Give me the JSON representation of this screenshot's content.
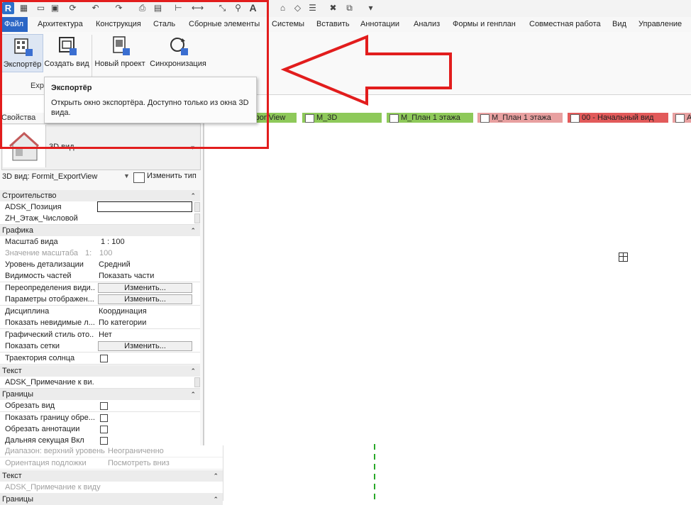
{
  "app": {
    "logo_letter": "R"
  },
  "quick_access": {
    "icons": [
      "open-icon",
      "save-icon",
      "sync-icon",
      "undo-icon",
      "redo-icon",
      "print-icon",
      "measure-icon",
      "dimension-icon",
      "tag-icon",
      "text-icon",
      "3d-view-icon",
      "section-icon",
      "thin-lines-icon",
      "close-views-icon",
      "switch-windows-icon"
    ]
  },
  "ribbon_tabs": [
    {
      "label": "Файл",
      "active": true
    },
    {
      "label": "Архитектура"
    },
    {
      "label": "Конструкция"
    },
    {
      "label": "Сталь"
    },
    {
      "label": "Сборные элементы"
    },
    {
      "label": "Системы"
    },
    {
      "label": "Вставить"
    },
    {
      "label": "Аннотации"
    },
    {
      "label": "Анализ"
    },
    {
      "label": "Формы и генплан"
    },
    {
      "label": "Совместная работа"
    },
    {
      "label": "Вид"
    },
    {
      "label": "Управление"
    }
  ],
  "ribbon": {
    "buttons": [
      {
        "label": "Экспортёр",
        "icon": "building-export-icon"
      },
      {
        "label": "Создать вид",
        "icon": "create-view-icon"
      },
      {
        "label": "Новый проект",
        "icon": "new-project-icon"
      },
      {
        "label": "Синхронизация",
        "icon": "sync-icon"
      }
    ],
    "panel_label": "Expo"
  },
  "tooltip": {
    "title": "Экспортёр",
    "body": "Открыть окно экспортёра. Доступно только из окна 3D вида."
  },
  "view_tabs": [
    {
      "label": "rportView",
      "color": "#8ec95a"
    },
    {
      "label": "M_3D",
      "color": "#8ec95a"
    },
    {
      "label": "M_План 1 этажа",
      "color": "#8ec95a"
    },
    {
      "label": "M_План 1 этажа",
      "color": "#e8a0a0"
    },
    {
      "label": "00 - Начальный вид",
      "color": "#e25a5a"
    },
    {
      "label": "A_",
      "color": "#e8a0a0"
    }
  ],
  "properties": {
    "title": "Свойства",
    "type_name": "3D вид",
    "instance_label": "3D вид: Formit_ExportView",
    "edit_type": "Изменить тип",
    "groups": [
      {
        "name": "Строительство"
      },
      {
        "name": "Графика"
      },
      {
        "name": "Текст"
      },
      {
        "name": "Границы"
      }
    ],
    "rows": {
      "adsk_pos": {
        "k": "ADSK_Позиция"
      },
      "zh_floor": {
        "k": "ZH_Этаж_Числовой"
      },
      "scale": {
        "k": "Масштаб вида",
        "v": "1 : 100"
      },
      "scale_val": {
        "k": "Значение масштаба",
        "k2": "1:",
        "v": "100"
      },
      "detail": {
        "k": "Уровень детализации",
        "v": "Средний"
      },
      "parts": {
        "k": "Видимость частей",
        "v": "Показать части"
      },
      "overrides": {
        "k": "Переопределения види...",
        "v": "Изменить..."
      },
      "display": {
        "k": "Параметры отображен...",
        "v": "Изменить..."
      },
      "discipline": {
        "k": "Дисциплина",
        "v": "Координация"
      },
      "hidden": {
        "k": "Показать невидимые л...",
        "v": "По категории"
      },
      "graphic": {
        "k": "Графический стиль ото...",
        "v": "Нет"
      },
      "grids": {
        "k": "Показать сетки",
        "v": "Изменить..."
      },
      "sun": {
        "k": "Траектория солнца"
      },
      "note": {
        "k": "ADSK_Примечание к ви..."
      },
      "crop": {
        "k": "Обрезать вид"
      },
      "crop_show": {
        "k": "Показать границу обре..."
      },
      "crop_ann": {
        "k": "Обрезать аннотации"
      },
      "far_clip": {
        "k": "Дальняя секущая Вкл"
      }
    },
    "lower": {
      "range": {
        "k": "Диапазон: верхний уровень",
        "v": "Неограниченно"
      },
      "orient": {
        "k": "Ориентация подложки",
        "v": "Посмотреть вниз"
      },
      "text_group": "Текст",
      "note": {
        "k": "ADSK_Примечание к виду"
      },
      "bounds_group": "Границы"
    }
  }
}
